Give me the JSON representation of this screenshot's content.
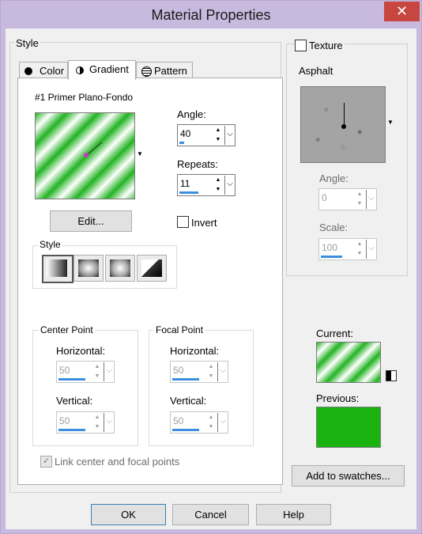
{
  "window": {
    "title": "Material Properties",
    "close_glyph": "✕"
  },
  "style_group": {
    "label": "Style"
  },
  "tabs": [
    {
      "label": "Color",
      "icon": "filled-circle-icon",
      "selected": false
    },
    {
      "label": "Gradient",
      "icon": "half-circle-icon",
      "selected": true
    },
    {
      "label": "Pattern",
      "icon": "pattern-icon",
      "selected": false
    }
  ],
  "gradient": {
    "name": "#1 Primer Plano-Fondo",
    "colors": {
      "primary": "#22b322",
      "secondary": "#ffffff"
    },
    "edit_label": "Edit...",
    "angle": {
      "label": "Angle:",
      "value": "40",
      "fraction": 0.11
    },
    "repeats": {
      "label": "Repeats:",
      "value": "11",
      "fraction": 0.55
    },
    "invert": {
      "label": "Invert",
      "checked": false
    },
    "style": {
      "label": "Style",
      "options": [
        "linear",
        "rectangular",
        "sunburst",
        "radial"
      ],
      "selected": "linear"
    },
    "center_point": {
      "label": "Center Point",
      "horizontal": {
        "label": "Horizontal:",
        "value": "50",
        "fraction": 0.5
      },
      "vertical": {
        "label": "Vertical:",
        "value": "50",
        "fraction": 0.5
      }
    },
    "focal_point": {
      "label": "Focal Point",
      "horizontal": {
        "label": "Horizontal:",
        "value": "50",
        "fraction": 0.5
      },
      "vertical": {
        "label": "Vertical:",
        "value": "50",
        "fraction": 0.5
      }
    },
    "link_points": {
      "label": "Link center and focal points",
      "checked": true
    }
  },
  "texture": {
    "label": "Texture",
    "checked": false,
    "name": "Asphalt",
    "angle": {
      "label": "Angle:",
      "value": "0",
      "fraction": 0.0
    },
    "scale": {
      "label": "Scale:",
      "value": "100",
      "fraction": 0.5
    }
  },
  "swatch": {
    "current_label": "Current:",
    "previous_label": "Previous:",
    "previous_color": "#1bb310",
    "add_label": "Add to swatches..."
  },
  "buttons": {
    "ok": "OK",
    "cancel": "Cancel",
    "help": "Help"
  }
}
